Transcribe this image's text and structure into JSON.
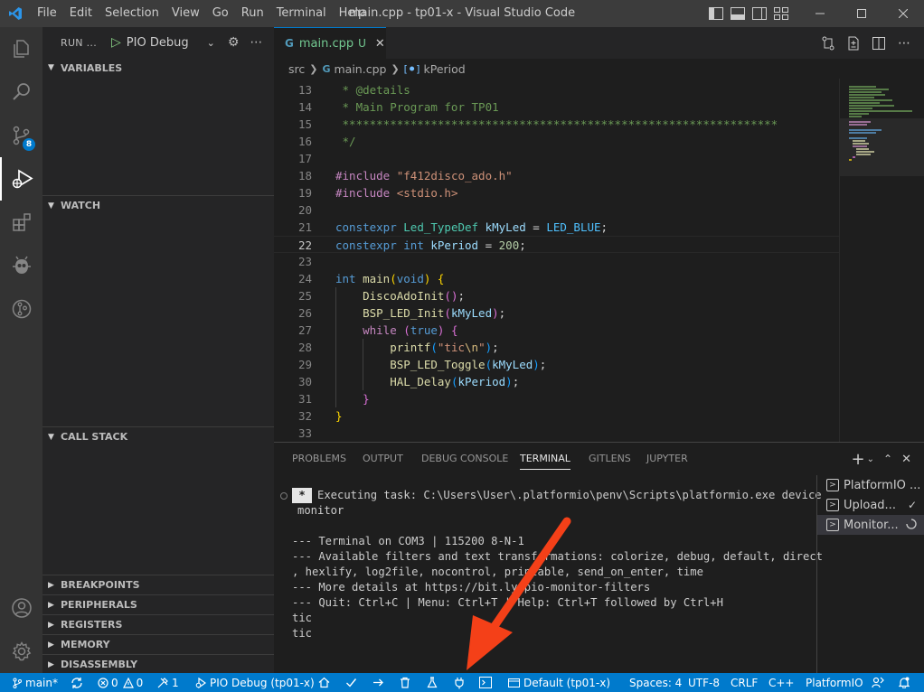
{
  "window": {
    "title": "main.cpp - tp01-x - Visual Studio Code",
    "menu": [
      "File",
      "Edit",
      "Selection",
      "View",
      "Go",
      "Run",
      "Terminal",
      "Help"
    ]
  },
  "activity_bar": {
    "items": [
      "explorer",
      "search",
      "source-control",
      "run-and-debug",
      "extensions",
      "platformio",
      "gitlens",
      "accounts",
      "manage"
    ],
    "source_control_badge": "8"
  },
  "sidebar": {
    "header": "RUN ...",
    "config": "PIO Debug",
    "sections": {
      "variables": "VARIABLES",
      "watch": "WATCH",
      "call_stack": "CALL STACK",
      "breakpoints": "BREAKPOINTS",
      "peripherals": "PERIPHERALS",
      "registers": "REGISTERS",
      "memory": "MEMORY",
      "disassembly": "DISASSEMBLY"
    }
  },
  "editor": {
    "tab": {
      "label": "main.cpp",
      "status": "U"
    },
    "breadcrumb": [
      "src",
      "main.cpp",
      "kPeriod"
    ],
    "lines": [
      {
        "n": "13",
        "tokens": [
          [
            " * @details",
            "com"
          ]
        ]
      },
      {
        "n": "14",
        "tokens": [
          [
            " * Main Program for TP01",
            "com"
          ]
        ]
      },
      {
        "n": "15",
        "tokens": [
          [
            " ****************************************************************",
            "com"
          ]
        ]
      },
      {
        "n": "16",
        "tokens": [
          [
            " */",
            "com"
          ]
        ]
      },
      {
        "n": "17",
        "tokens": []
      },
      {
        "n": "18",
        "tokens": [
          [
            "#include",
            "ctrl"
          ],
          [
            " ",
            "pun"
          ],
          [
            "\"f412disco_ado.h\"",
            "str"
          ]
        ]
      },
      {
        "n": "19",
        "tokens": [
          [
            "#include",
            "ctrl"
          ],
          [
            " ",
            "pun"
          ],
          [
            "<stdio.h>",
            "str"
          ]
        ]
      },
      {
        "n": "20",
        "tokens": []
      },
      {
        "n": "21",
        "tokens": [
          [
            "constexpr",
            "kw"
          ],
          [
            " ",
            "pun"
          ],
          [
            "Led_TypeDef",
            "type"
          ],
          [
            " ",
            "pun"
          ],
          [
            "kMyLed",
            "var"
          ],
          [
            " = ",
            "pun"
          ],
          [
            "LED_BLUE",
            "const"
          ],
          [
            ";",
            "pun"
          ]
        ]
      },
      {
        "n": "22",
        "tokens": [
          [
            "constexpr",
            "kw"
          ],
          [
            " ",
            "pun"
          ],
          [
            "int",
            "kw"
          ],
          [
            " ",
            "pun"
          ],
          [
            "kPeriod",
            "var"
          ],
          [
            " = ",
            "pun"
          ],
          [
            "200",
            "num"
          ],
          [
            ";",
            "pun"
          ]
        ]
      },
      {
        "n": "23",
        "tokens": []
      },
      {
        "n": "24",
        "tokens": [
          [
            "int",
            "kw"
          ],
          [
            " ",
            "pun"
          ],
          [
            "main",
            "fn"
          ],
          [
            "(",
            "br1"
          ],
          [
            "void",
            "kw"
          ],
          [
            ")",
            "br1"
          ],
          [
            " ",
            "pun"
          ],
          [
            "{",
            "br1"
          ]
        ]
      },
      {
        "n": "25",
        "tokens": [
          [
            "    ",
            "pun"
          ],
          [
            "DiscoAdoInit",
            "fn"
          ],
          [
            "()",
            "br2"
          ],
          [
            ";",
            "pun"
          ]
        ]
      },
      {
        "n": "26",
        "tokens": [
          [
            "    ",
            "pun"
          ],
          [
            "BSP_LED_Init",
            "fn"
          ],
          [
            "(",
            "br2"
          ],
          [
            "kMyLed",
            "var"
          ],
          [
            ")",
            "br2"
          ],
          [
            ";",
            "pun"
          ]
        ]
      },
      {
        "n": "27",
        "tokens": [
          [
            "    ",
            "pun"
          ],
          [
            "while",
            "ctrl"
          ],
          [
            " ",
            "pun"
          ],
          [
            "(",
            "br2"
          ],
          [
            "true",
            "kw"
          ],
          [
            ")",
            "br2"
          ],
          [
            " ",
            "pun"
          ],
          [
            "{",
            "br2"
          ]
        ]
      },
      {
        "n": "28",
        "tokens": [
          [
            "        ",
            "pun"
          ],
          [
            "printf",
            "fn"
          ],
          [
            "(",
            "br3"
          ],
          [
            "\"tic",
            "str"
          ],
          [
            "\\n",
            "esc"
          ],
          [
            "\"",
            "str"
          ],
          [
            ")",
            "br3"
          ],
          [
            ";",
            "pun"
          ]
        ]
      },
      {
        "n": "29",
        "tokens": [
          [
            "        ",
            "pun"
          ],
          [
            "BSP_LED_Toggle",
            "fn"
          ],
          [
            "(",
            "br3"
          ],
          [
            "kMyLed",
            "var"
          ],
          [
            ")",
            "br3"
          ],
          [
            ";",
            "pun"
          ]
        ]
      },
      {
        "n": "30",
        "tokens": [
          [
            "        ",
            "pun"
          ],
          [
            "HAL_Delay",
            "fn"
          ],
          [
            "(",
            "br3"
          ],
          [
            "kPeriod",
            "var"
          ],
          [
            ")",
            "br3"
          ],
          [
            ";",
            "pun"
          ]
        ]
      },
      {
        "n": "31",
        "tokens": [
          [
            "    ",
            "pun"
          ],
          [
            "}",
            "br2"
          ]
        ]
      },
      {
        "n": "32",
        "tokens": [
          [
            "}",
            "br1"
          ]
        ]
      },
      {
        "n": "33",
        "tokens": []
      }
    ],
    "current_line": "22"
  },
  "panel": {
    "tabs": [
      "PROBLEMS",
      "OUTPUT",
      "DEBUG CONSOLE",
      "TERMINAL",
      "GITLENS",
      "JUPYTER"
    ],
    "active_tab": "TERMINAL",
    "terminal_lines": [
      "Executing task: C:\\Users\\User\\.platformio\\penv\\Scripts\\platformio.exe device",
      "monitor",
      "",
      "--- Terminal on COM3 | 115200 8-N-1",
      "--- Available filters and text transformations: colorize, debug, default, direct",
      ", hexlify, log2file, nocontrol, printable, send_on_enter, time",
      "--- More details at https://bit.ly/pio-monitor-filters",
      "--- Quit: Ctrl+C | Menu: Ctrl+T | Help: Ctrl+T followed by Ctrl+H",
      "tic",
      "tic"
    ],
    "terminals": [
      {
        "label": "PlatformIO ...",
        "status": ""
      },
      {
        "label": "Upload...",
        "status": "check"
      },
      {
        "label": "Monitor...",
        "status": "spinner"
      }
    ]
  },
  "statusbar": {
    "branch": "main*",
    "errors": "0",
    "warnings": "0",
    "tools_count": "1",
    "debug_config": "PIO Debug (tp01-x)",
    "env": "Default (tp01-x)",
    "spaces": "Spaces: 4",
    "encoding": "UTF-8",
    "eol": "CRLF",
    "language": "C++",
    "platformio": "PlatformIO"
  },
  "colors": {
    "statusbar": "#007acc",
    "annotation_arrow": "#f44018",
    "accent": "#007acc"
  }
}
